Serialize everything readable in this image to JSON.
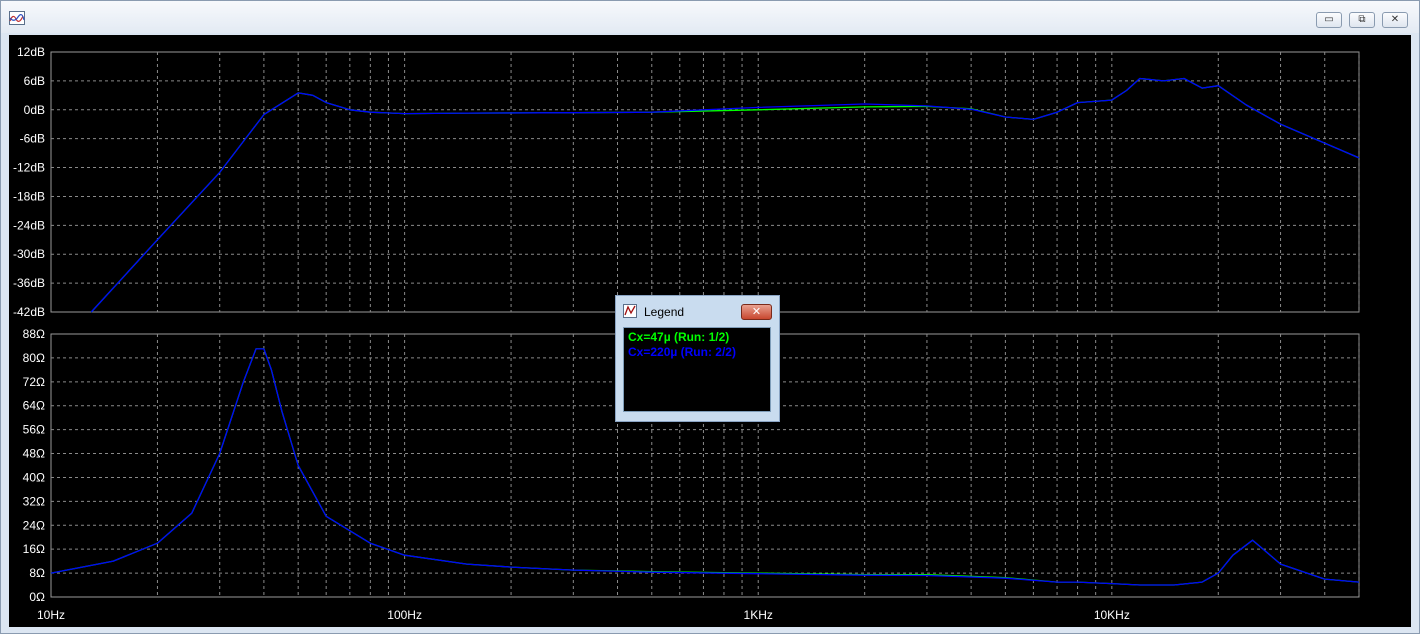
{
  "window": {
    "controls": {
      "minimize": "▭",
      "restore": "⧉",
      "close": "✕"
    }
  },
  "chart_data": [
    {
      "type": "line",
      "panel": "magnitude",
      "xscale": "log",
      "xlim": [
        10,
        50000
      ],
      "ylim": [
        -42,
        12
      ],
      "ytick_labels": [
        "12dB",
        "6dB",
        "0dB",
        "-6dB",
        "-12dB",
        "-18dB",
        "-24dB",
        "-30dB",
        "-36dB",
        "-42dB"
      ],
      "ytick_values": [
        12,
        6,
        0,
        -6,
        -12,
        -18,
        -24,
        -30,
        -36,
        -42
      ],
      "grid": true,
      "series": [
        {
          "name": "Cx=47µ  (Run: 1/2)",
          "color": "#00ff00",
          "x": [
            13,
            20,
            30,
            40,
            50,
            55,
            60,
            70,
            80,
            100,
            150,
            300,
            500,
            1000,
            2000,
            3000,
            4000,
            5000,
            6000,
            7000,
            8000,
            10000,
            11000,
            12000,
            14000,
            16000,
            18000,
            20000,
            24000,
            30000,
            50000
          ],
          "y": [
            -42,
            -27,
            -13,
            -1,
            3.5,
            3,
            1.5,
            0,
            -0.5,
            -0.8,
            -0.7,
            -0.6,
            -0.5,
            0,
            0.6,
            0.7,
            0.2,
            -1.5,
            -2,
            -0.5,
            1.5,
            2,
            4,
            6.5,
            6,
            6.5,
            4.5,
            5,
            1,
            -3,
            -10
          ]
        },
        {
          "name": "Cx=220µ  (Run: 2/2)",
          "color": "#0000ff",
          "x": [
            13,
            20,
            30,
            40,
            50,
            55,
            60,
            70,
            80,
            100,
            150,
            300,
            500,
            1000,
            2000,
            3000,
            4000,
            5000,
            6000,
            7000,
            8000,
            10000,
            11000,
            12000,
            14000,
            16000,
            18000,
            20000,
            24000,
            30000,
            50000
          ],
          "y": [
            -42,
            -27,
            -13,
            -1,
            3.5,
            3,
            1.5,
            0,
            -0.5,
            -0.8,
            -0.7,
            -0.6,
            -0.5,
            0.5,
            1.2,
            0.8,
            0.1,
            -1.5,
            -2,
            -0.5,
            1.5,
            2,
            4,
            6.5,
            6,
            6.5,
            4.5,
            5,
            1,
            -3,
            -10
          ]
        }
      ]
    },
    {
      "type": "line",
      "panel": "impedance",
      "xscale": "log",
      "xlim": [
        10,
        50000
      ],
      "ylim": [
        0,
        88
      ],
      "ytick_labels": [
        "88Ω",
        "80Ω",
        "72Ω",
        "64Ω",
        "56Ω",
        "48Ω",
        "40Ω",
        "32Ω",
        "24Ω",
        "16Ω",
        "8Ω",
        "0Ω"
      ],
      "ytick_values": [
        88,
        80,
        72,
        64,
        56,
        48,
        40,
        32,
        24,
        16,
        8,
        0
      ],
      "xtick_labels": [
        "10Hz",
        "100Hz",
        "1KHz",
        "10KHz"
      ],
      "xtick_values": [
        10,
        100,
        1000,
        10000
      ],
      "grid": true,
      "series": [
        {
          "name": "Cx=47µ  (Run: 1/2)",
          "color": "#00ff00",
          "x": [
            10,
            15,
            20,
            25,
            30,
            35,
            38,
            40,
            42,
            45,
            50,
            60,
            80,
            100,
            150,
            200,
            300,
            500,
            1000,
            2000,
            3000,
            5000,
            7000,
            8000,
            10000,
            12000,
            15000,
            18000,
            20000,
            22000,
            25000,
            30000,
            40000,
            50000
          ],
          "y": [
            8,
            12,
            18,
            28,
            48,
            72,
            83,
            83,
            76,
            62,
            44,
            27,
            18,
            14,
            11,
            10,
            9,
            8.5,
            8,
            7.5,
            7.5,
            6.5,
            5,
            5,
            4.5,
            4,
            4,
            5,
            8,
            14,
            19,
            11,
            6,
            5
          ]
        },
        {
          "name": "Cx=220µ  (Run: 2/2)",
          "color": "#0000ff",
          "x": [
            10,
            15,
            20,
            25,
            30,
            35,
            38,
            40,
            42,
            45,
            50,
            60,
            80,
            100,
            150,
            200,
            300,
            500,
            1000,
            2000,
            3000,
            5000,
            7000,
            8000,
            10000,
            12000,
            15000,
            18000,
            20000,
            22000,
            25000,
            30000,
            40000,
            50000
          ],
          "y": [
            8,
            12,
            18,
            28,
            48,
            72,
            83,
            83,
            76,
            62,
            44,
            27,
            18,
            14,
            11,
            10,
            9,
            8.3,
            7.8,
            7.3,
            7.2,
            6.3,
            5,
            5,
            4.5,
            4,
            4,
            5,
            8,
            14,
            19,
            11,
            6,
            5
          ]
        }
      ]
    }
  ],
  "legend": {
    "title": "Legend",
    "close": "✕",
    "entries": [
      {
        "label": "Cx=47µ  (Run: 1/2)",
        "color": "#00ff00"
      },
      {
        "label": "Cx=220µ  (Run: 2/2)",
        "color": "#0000ff"
      }
    ]
  }
}
